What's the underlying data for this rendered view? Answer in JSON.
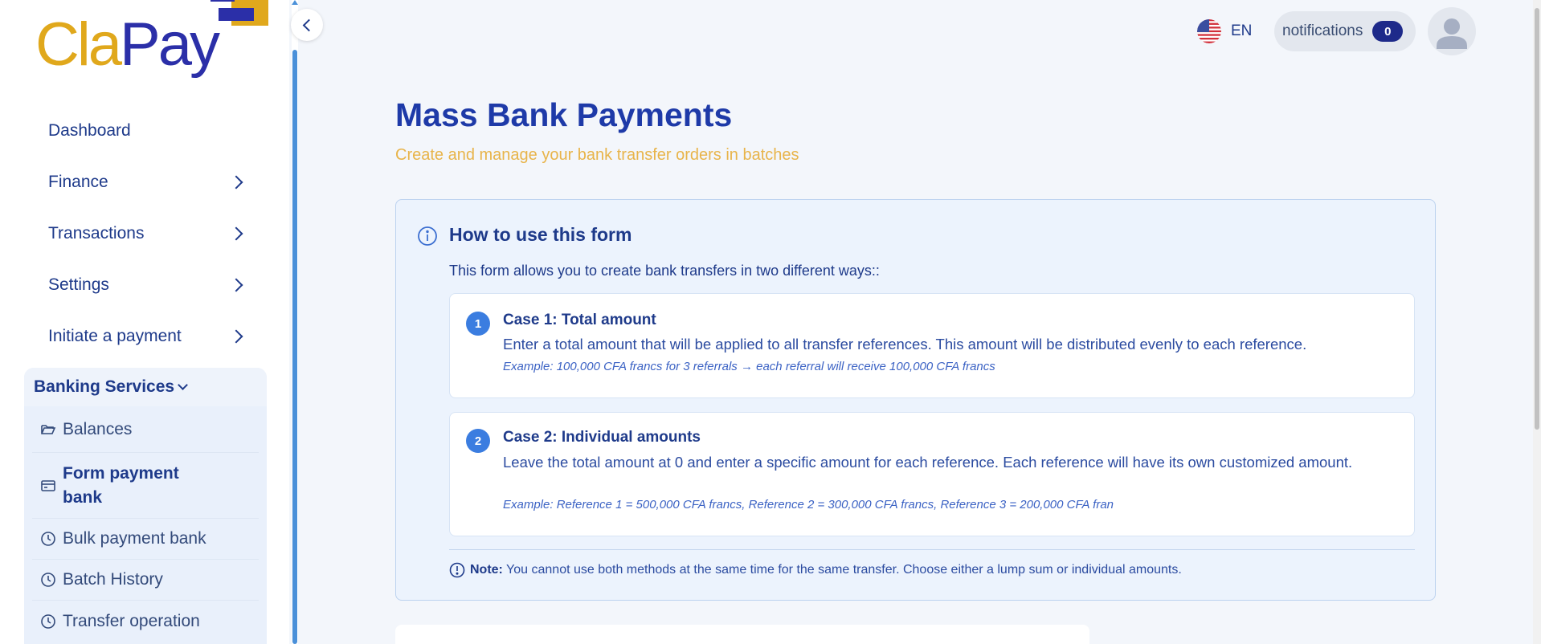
{
  "logo": {
    "part1": "Cla",
    "part2": "Pay"
  },
  "sidebar": {
    "items": [
      {
        "label": "Dashboard",
        "has_submenu": false
      },
      {
        "label": "Finance",
        "has_submenu": true
      },
      {
        "label": "Transactions",
        "has_submenu": true
      },
      {
        "label": "Settings",
        "has_submenu": true
      },
      {
        "label": "Initiate a payment",
        "has_submenu": true
      }
    ],
    "group": {
      "label": "Banking Services",
      "expanded": true,
      "items": [
        {
          "label": "Balances",
          "icon": "folder-open-icon",
          "active": false
        },
        {
          "label": "Form payment bank",
          "icon": "credit-card-icon",
          "active": true
        },
        {
          "label": "Bulk payment bank",
          "icon": "clock-icon",
          "active": false
        },
        {
          "label": "Batch History",
          "icon": "clock-icon",
          "active": false
        },
        {
          "label": "Transfer operation",
          "icon": "clock-icon",
          "active": false
        }
      ]
    }
  },
  "topbar": {
    "language": "EN",
    "notifications_label": "notifications",
    "notifications_count": "0"
  },
  "main": {
    "title": "Mass Bank Payments",
    "subtitle": "Create and manage your bank transfer orders in batches",
    "info": {
      "title": "How to use this form",
      "intro": "This form allows you to create bank transfers in two different ways::",
      "cases": [
        {
          "number": "1",
          "title": "Case 1: Total amount",
          "description": "Enter a total amount that will be applied to all transfer references. This amount will be distributed evenly to each reference.",
          "example": "Example: 100,000 CFA francs for 3 referrals → each referral will receive 100,000 CFA francs"
        },
        {
          "number": "2",
          "title": "Case 2: Individual amounts",
          "description": "Leave the total amount at 0 and enter a specific amount for each reference. Each reference will have its own customized amount.",
          "example": "Example: Reference 1 = 500,000 CFA francs, Reference 2 = 300,000 CFA francs, Reference 3 = 200,000 CFA fran"
        }
      ],
      "note_label": "Note:",
      "note_text": "You cannot use both methods at the same time for the same transfer. Choose either a lump sum or individual amounts."
    }
  },
  "colors": {
    "primary": "#1e3a8a",
    "accent": "#e8b44a",
    "logo_yellow": "#e0a81c",
    "logo_blue": "#2b2fa8",
    "info_bg": "#ecf3fd",
    "badge": "#1e2a8a"
  }
}
